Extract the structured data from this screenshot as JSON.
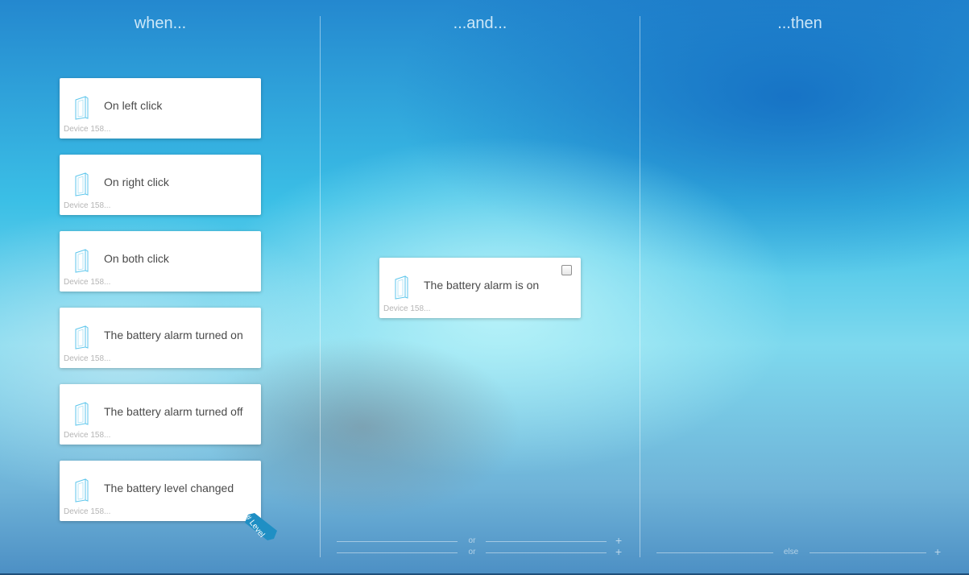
{
  "columns": {
    "when": "when...",
    "and": "...and...",
    "then": "...then"
  },
  "when_cards": [
    {
      "label": "On left click",
      "device": "Device 158..."
    },
    {
      "label": "On right click",
      "device": "Device 158..."
    },
    {
      "label": "On both click",
      "device": "Device 158..."
    },
    {
      "label": "The battery alarm turned on",
      "device": "Device 158..."
    },
    {
      "label": "The battery alarm turned off",
      "device": "Device 158..."
    },
    {
      "label": "The battery level changed",
      "device": "Device 158..."
    }
  ],
  "and_cards": [
    {
      "label": "The battery alarm is on",
      "device": "Device 158...",
      "checked": false
    }
  ],
  "level_tag": "# Level",
  "and_footer": {
    "rows": [
      {
        "word": "or",
        "plus": "+"
      },
      {
        "word": "or",
        "plus": "+"
      }
    ]
  },
  "then_footer": {
    "word": "else",
    "plus": "+"
  },
  "icons": {
    "device": "wall-switch-device-icon",
    "add": "plus-icon"
  },
  "colors": {
    "accent": "#1f8fc4",
    "card_bg": "#ffffff",
    "icon_stroke": "#5cc6ec"
  }
}
